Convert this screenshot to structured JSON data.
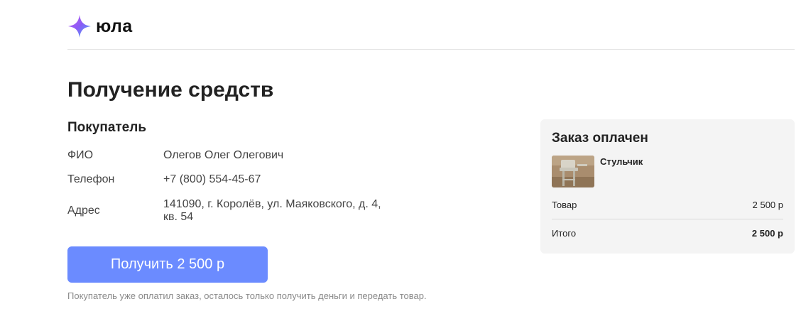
{
  "brand": {
    "name": "юла",
    "colors": {
      "star_top": "#8a5cf6",
      "star_left": "#c65df0",
      "star_right": "#42b4f5"
    }
  },
  "page": {
    "title": "Получение средств"
  },
  "buyer": {
    "section_title": "Покупатель",
    "fields": [
      {
        "label": "ФИО",
        "value": "Олегов Олег Олегович"
      },
      {
        "label": "Телефон",
        "value": "+7 (800) 554-45-67"
      },
      {
        "label": "Адрес",
        "value": "141090, г. Королёв, ул. Маяковского, д. 4, кв. 54"
      }
    ]
  },
  "action": {
    "button_label": "Получить 2 500 р",
    "button_color": "#6b8bff",
    "hint": "Покупатель уже оплатил заказ, осталось только получить деньги и передать товар."
  },
  "order": {
    "title": "Заказ оплачен",
    "product_name": "Стульчик",
    "thumbnail_icon": "high-chair-photo",
    "summary": [
      {
        "label": "Товар",
        "value": "2 500 р"
      },
      {
        "label": "Итого",
        "value": "2 500 р"
      }
    ]
  }
}
